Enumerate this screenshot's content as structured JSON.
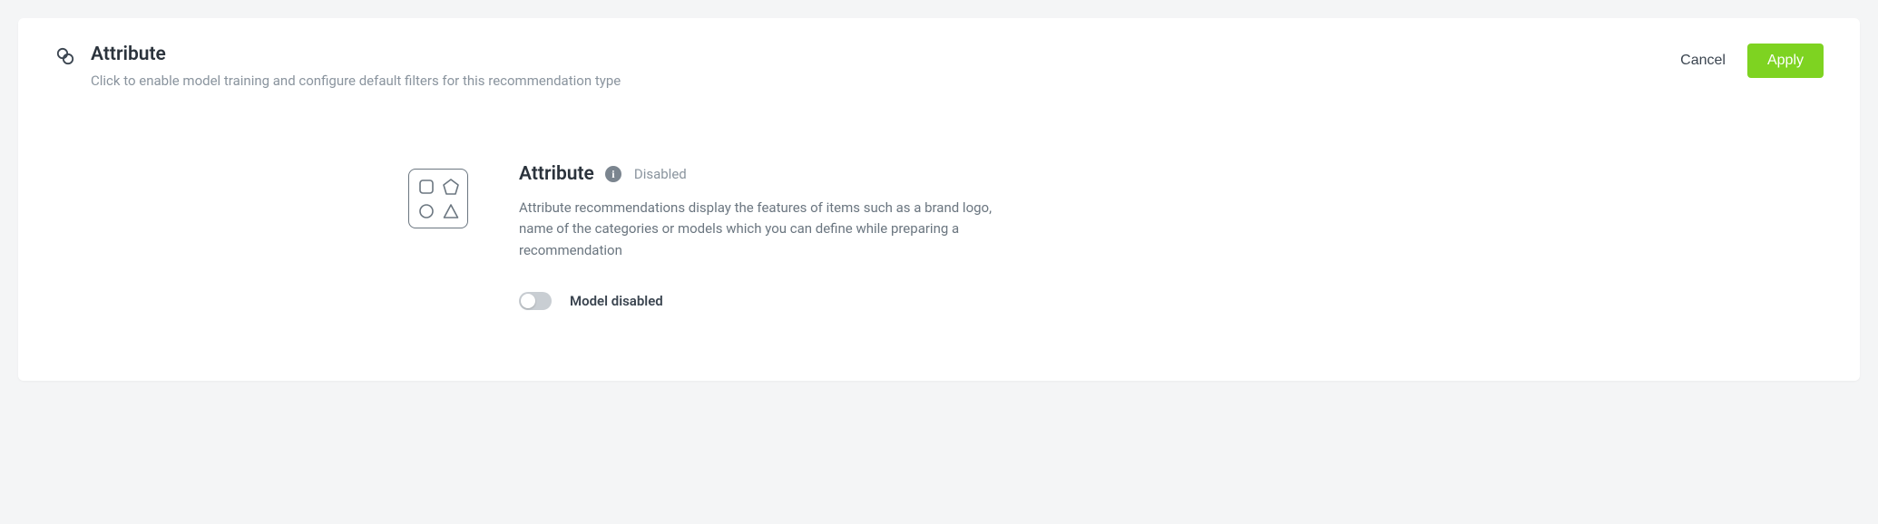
{
  "header": {
    "title": "Attribute",
    "subtitle": "Click to enable model training and configure default filters for this recommendation type",
    "cancel_label": "Cancel",
    "apply_label": "Apply"
  },
  "section": {
    "title": "Attribute",
    "status": "Disabled",
    "description": "Attribute recommendations display the features of items such as a brand logo, name of the categories or models which you can define while preparing a recommendation",
    "toggle_label": "Model disabled",
    "toggle_on": false
  },
  "colors": {
    "apply_bg": "#7ed321"
  }
}
